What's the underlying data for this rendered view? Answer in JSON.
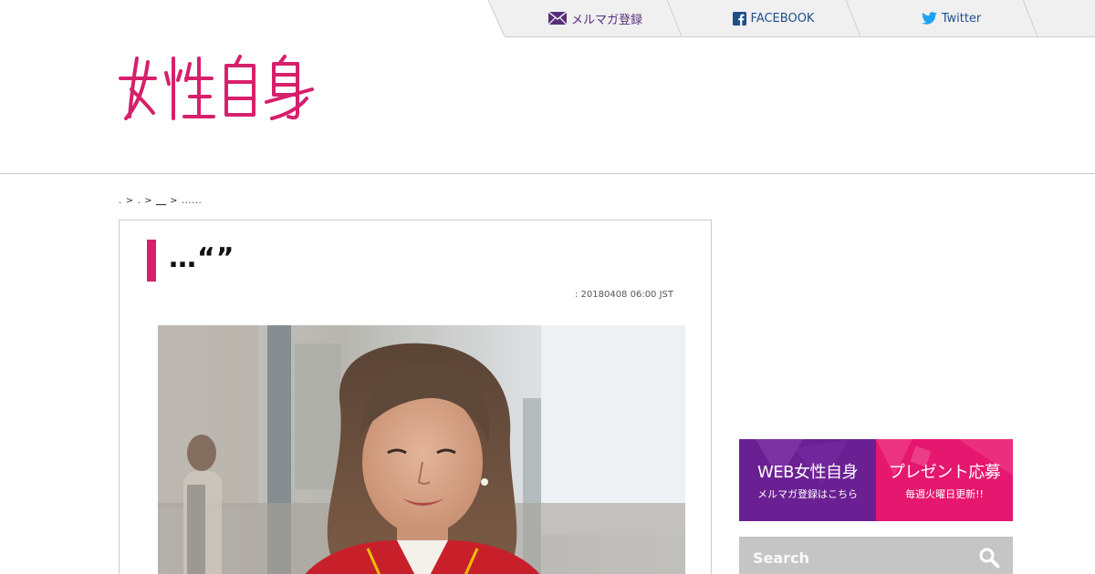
{
  "nav": {
    "mail_label": "メルマガ登録",
    "facebook_label": "FACEBOOK",
    "twitter_label": "Twitter"
  },
  "logo": {
    "text": "女性自身"
  },
  "breadcrumb": {
    "items": [
      ".",
      ">",
      ".",
      ">",
      "__",
      ">",
      "......"
    ]
  },
  "article": {
    "title": "…“”",
    "date": ": 20180408 06:00 JST"
  },
  "banner": {
    "left_big": "WEB女性自身",
    "left_small": "メルマガ登録はこちら",
    "right_big": "プレゼント応募",
    "right_small": "毎週火曜日更新!!"
  },
  "search": {
    "placeholder": "Search"
  },
  "colors": {
    "brand": "#d6206b",
    "purple": "#6a1f92",
    "pink": "#e5176e",
    "link": "#1f4e8a"
  },
  "icons": [
    "mail-icon",
    "facebook-icon",
    "twitter-icon",
    "search-icon"
  ]
}
